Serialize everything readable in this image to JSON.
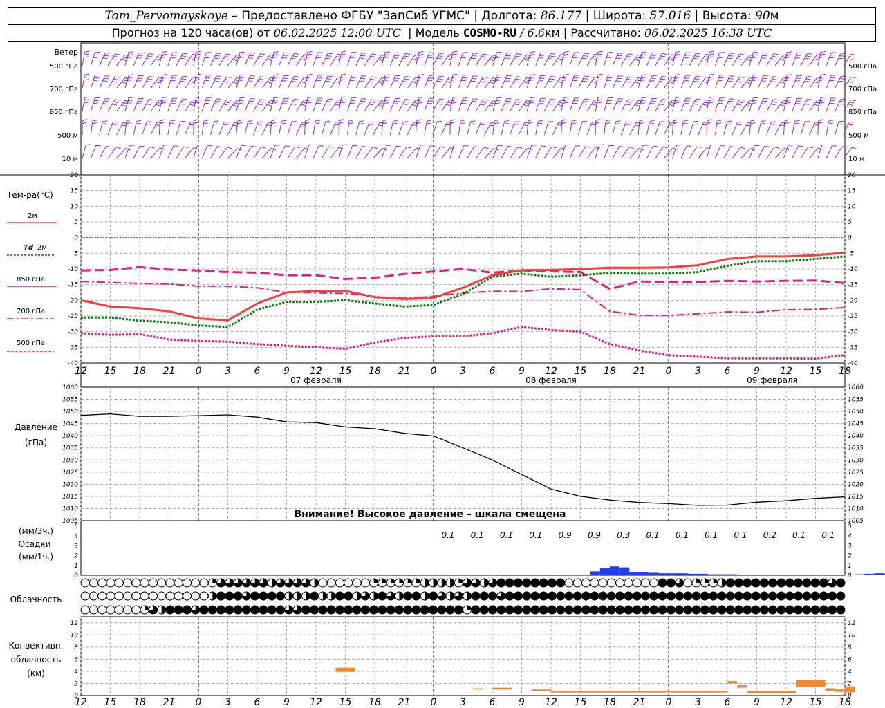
{
  "header": {
    "station": "Tom_Pervomayskoye",
    "dash": "–",
    "provided_by": "Предоставлено ФГБУ \"ЗапСиб УГМС\"",
    "lon_label": "Долгота:",
    "lon_value": "86.177",
    "lat_label": "Широта:",
    "lat_value": "57.016",
    "alt_label": "Высота:",
    "alt_value": "90",
    "alt_unit": "м",
    "forecast_prefix": "Прогноз на 120 часа(ов) от",
    "forecast_time": "06.02.2025 12:00 UTC",
    "model_label": "Модель",
    "model_name": "COSMO-RU",
    "model_res": "/ 6.6",
    "model_res_unit": "км",
    "calc_label": "Рассчитано:",
    "calc_time": "06.02.2025 16:38 UTC"
  },
  "labels": {
    "wind": "Ветер",
    "wind_levels": [
      "500 гПа",
      "700 гПа",
      "850 гПа",
      "500 м",
      "10 м"
    ],
    "temp_title": "Тем-ра(°C)",
    "temp_2m": "2м",
    "td_prefix": "Td",
    "td_2m": "2м",
    "t850": "850 гПа",
    "t700": "700 гПа",
    "t500": "500 гПа",
    "pressure_title": "Давление",
    "pressure_unit": "(гПа)",
    "pressure_warning": "Внимание! Высокое давление – шкала смещена",
    "precip_unit_top": "(мм/3ч.)",
    "precip_title": "Осадки",
    "precip_unit_bottom": "(мм/1ч.)",
    "cloud_title": "Облачность",
    "conv_title1": "Конвективн.",
    "conv_title2": "облачность",
    "conv_title3": "(км)"
  },
  "colors": {
    "wind": "#8b2be2",
    "t2m": "#f04040",
    "td2m": "#0a7a0a",
    "t850": "#e0207a",
    "t700": "#e0207a",
    "t500": "#e0207a",
    "pressure": "#000000",
    "precip": "#1f3ff0",
    "convective": "#f08a30",
    "zero_line": "#4060e0"
  },
  "chart_data": {
    "type": "line",
    "time_axis": {
      "hours_utc": [
        12,
        15,
        18,
        21,
        0,
        3,
        6,
        9,
        12,
        15,
        18,
        21,
        0,
        3,
        6,
        9,
        12,
        15,
        18,
        21,
        0,
        3,
        6,
        9,
        12,
        15,
        18
      ],
      "day_labels": [
        "07 февраля",
        "08 февраля",
        "09 февраля"
      ]
    },
    "temperature": {
      "ylim": [
        -40,
        20
      ],
      "yticks": [
        20,
        15,
        10,
        5,
        0,
        -5,
        -10,
        -15,
        -20,
        -25,
        -30,
        -35,
        -40
      ],
      "t2m": [
        -20,
        -22,
        -22.5,
        -23.5,
        -25.8,
        -26.4,
        -21,
        -17.5,
        -17,
        -17,
        -19,
        -19.6,
        -19.2,
        -16,
        -12,
        -10.4,
        -10.3,
        -10,
        -9.6,
        -9.6,
        -9.5,
        -8.8,
        -6.8,
        -6,
        -6,
        -5.6,
        -4.8
      ],
      "td2m": [
        -25.5,
        -25.5,
        -26.5,
        -27,
        -28,
        -28.5,
        -23,
        -20.5,
        -20.5,
        -20,
        -21,
        -22,
        -21.5,
        -18,
        -12.5,
        -11.5,
        -12.5,
        -12,
        -11.3,
        -11.5,
        -11.5,
        -11,
        -9,
        -7.5,
        -7.5,
        -6.8,
        -6
      ],
      "t850": [
        -10.5,
        -10.3,
        -9.4,
        -10.2,
        -10.5,
        -11,
        -11.2,
        -12,
        -12,
        -13.2,
        -12.8,
        -11.6,
        -10.8,
        -10,
        -11.2,
        -10.5,
        -10.8,
        -11,
        -16.4,
        -14,
        -14.2,
        -14.2,
        -13.8,
        -14,
        -13.8,
        -13.7,
        -14.5
      ],
      "t700": [
        -14,
        -14.3,
        -14.6,
        -14.8,
        -15.5,
        -15.5,
        -16,
        -17.5,
        -17.6,
        -17.8,
        -18.8,
        -19.3,
        -18.7,
        -17.7,
        -17.1,
        -17.2,
        -16.3,
        -16.6,
        -23.5,
        -24.8,
        -24.8,
        -24.3,
        -23.7,
        -23.8,
        -23,
        -22.9,
        -22.3
      ],
      "t500": [
        -30.5,
        -31,
        -30.8,
        -32.5,
        -33,
        -33.2,
        -34,
        -34.5,
        -35,
        -35.5,
        -33.5,
        -32,
        -31.5,
        -31.5,
        -30.5,
        -28.5,
        -29.5,
        -30,
        -34,
        -36,
        -37.5,
        -38,
        -38.5,
        -38.5,
        -38.5,
        -38.6,
        -37.5
      ]
    },
    "pressure": {
      "ylim": [
        1005,
        1060
      ],
      "yticks": [
        1060,
        1055,
        1050,
        1045,
        1040,
        1035,
        1030,
        1025,
        1020,
        1015,
        1010,
        1005
      ],
      "values": [
        1048.4,
        1049,
        1048,
        1048,
        1048.3,
        1048.6,
        1047.7,
        1045.7,
        1045.4,
        1043.6,
        1042.9,
        1041,
        1039.9,
        1035,
        1030,
        1024,
        1018,
        1015,
        1013.5,
        1012.5,
        1012,
        1011.3,
        1011.4,
        1012.6,
        1013.2,
        1014.2,
        1014.8
      ]
    },
    "precipitation": {
      "ylim_3h": [
        0,
        5
      ],
      "yticks": [
        5,
        4,
        3,
        2,
        1,
        0
      ],
      "labels_3h": [
        "0.1",
        "0.1",
        "0.1",
        "0.1",
        "0.9",
        "0.9",
        "0.3",
        "0.1",
        "0.1",
        "0.1",
        "0.1",
        "0.2",
        "0.1",
        "0.1"
      ],
      "hourly": [
        0,
        0,
        0,
        0,
        0,
        0,
        0,
        0,
        0,
        0,
        0,
        0,
        0,
        0,
        0,
        0,
        0,
        0,
        0,
        0,
        0,
        0,
        0,
        0,
        0,
        0,
        0,
        0,
        0,
        0,
        0,
        0,
        0,
        0,
        0,
        0,
        0,
        0,
        0,
        0,
        0.05,
        0.05,
        0.05,
        0.05,
        0.05,
        0.05,
        0.05,
        0.05,
        0.05,
        0.05,
        0.05,
        0.05,
        0.4,
        0.7,
        0.9,
        0.8,
        0.3,
        0.3,
        0.25,
        0.2,
        0.2,
        0.2,
        0.15,
        0.15,
        0.1,
        0.1,
        0.1,
        0.05,
        0.05,
        0.05,
        0.05,
        0.05,
        0.05,
        0.05,
        0.05,
        0.05,
        0.05,
        0.05,
        0.05,
        0.1,
        0.15,
        0.2,
        0.15,
        0.1,
        0.05,
        0.05,
        0.1,
        0.15,
        0.15,
        0.1
      ]
    },
    "cloudiness": {
      "note": "three rows: upper, middle, lower; fraction 0..1 per hour step",
      "upper": [
        0,
        0,
        0,
        0,
        0,
        0,
        0,
        0,
        0,
        0,
        0,
        0,
        0,
        0,
        0,
        0.25,
        0.75,
        0.75,
        0.75,
        0.75,
        0.75,
        0.75,
        0.5,
        0.75,
        0.75,
        0.75,
        0.75,
        0.5,
        0,
        0,
        0,
        0,
        0,
        0,
        0.25,
        0.25,
        0.25,
        0.25,
        0.25,
        0.25,
        0.5,
        0.5,
        0.5,
        0.5,
        0.25,
        0.75,
        0.75,
        0.5,
        0.75,
        1,
        1,
        1,
        1,
        1,
        1,
        1,
        1,
        0,
        0,
        0,
        0,
        0,
        0,
        0,
        0,
        0,
        0,
        0,
        1,
        1,
        0.75,
        0,
        0.25,
        0.25,
        0.25,
        0.5,
        1,
        1,
        1,
        1,
        1,
        1,
        1,
        1,
        1,
        1,
        1,
        1,
        0.75,
        1
      ],
      "middle": [
        0,
        0,
        0,
        0,
        0,
        0,
        0,
        0,
        0,
        0,
        0,
        0,
        0,
        0,
        0,
        0.5,
        1,
        1,
        1,
        0.75,
        1,
        1,
        1,
        1,
        0.5,
        0.5,
        0.5,
        1,
        0.5,
        0.5,
        1,
        1,
        0.5,
        0.75,
        0.5,
        1,
        0.75,
        0.5,
        1,
        1,
        0.5,
        1,
        0.75,
        0.5,
        0.75,
        0.5,
        1,
        1,
        1,
        0.75,
        1,
        1,
        1,
        1,
        1,
        1,
        1,
        1,
        1,
        1,
        1,
        1,
        1,
        1,
        1,
        1,
        1,
        1,
        1,
        1,
        1,
        1,
        1,
        1,
        1,
        1,
        1,
        1,
        1,
        1,
        1,
        1,
        1,
        1,
        1,
        1,
        1,
        1,
        1,
        1
      ],
      "lower": [
        0,
        0,
        0,
        0,
        0,
        0,
        0,
        0.25,
        0.75,
        0.5,
        1,
        1,
        1,
        0.75,
        1,
        1,
        1,
        1,
        1,
        1,
        1,
        1,
        1,
        1,
        0.75,
        0.75,
        1,
        1,
        1,
        1,
        1,
        1,
        1,
        1,
        1,
        1,
        1,
        1,
        1,
        1,
        1,
        1,
        1,
        1,
        1,
        0.25,
        1,
        1,
        1,
        1,
        1,
        1,
        1,
        1,
        1,
        1,
        1,
        1,
        1,
        1,
        1,
        1,
        1,
        1,
        1,
        1,
        1,
        1,
        1,
        1,
        1,
        1,
        1,
        1,
        1,
        1,
        1,
        1,
        1,
        1,
        1,
        1,
        1,
        1,
        1,
        1,
        1,
        1,
        1,
        1
      ]
    },
    "convective": {
      "ylim": [
        0,
        13
      ],
      "yticks": [
        12,
        10,
        8,
        6,
        4,
        2,
        0
      ],
      "blocks": [
        {
          "h_start": 26,
          "h_end": 28,
          "base": 3.9,
          "top": 4.6
        },
        {
          "h_start": 40,
          "h_end": 41,
          "base": 1.0,
          "top": 1.2
        },
        {
          "h_start": 42,
          "h_end": 44,
          "base": 1.0,
          "top": 1.3
        },
        {
          "h_start": 46,
          "h_end": 48,
          "base": 0.7,
          "top": 1.0
        },
        {
          "h_start": 48,
          "h_end": 66,
          "base": 0.5,
          "top": 0.8
        },
        {
          "h_start": 66,
          "h_end": 67,
          "base": 2.0,
          "top": 2.4
        },
        {
          "h_start": 67,
          "h_end": 68,
          "base": 1.3,
          "top": 1.7
        },
        {
          "h_start": 68,
          "h_end": 73,
          "base": 0.4,
          "top": 0.7
        },
        {
          "h_start": 73,
          "h_end": 76,
          "base": 1.4,
          "top": 2.6
        },
        {
          "h_start": 76,
          "h_end": 77,
          "base": 0.8,
          "top": 1.2
        },
        {
          "h_start": 77,
          "h_end": 78,
          "base": 0.6,
          "top": 1.0
        },
        {
          "h_start": 78,
          "h_end": 79,
          "base": 0.5,
          "top": 1.5
        }
      ]
    }
  }
}
